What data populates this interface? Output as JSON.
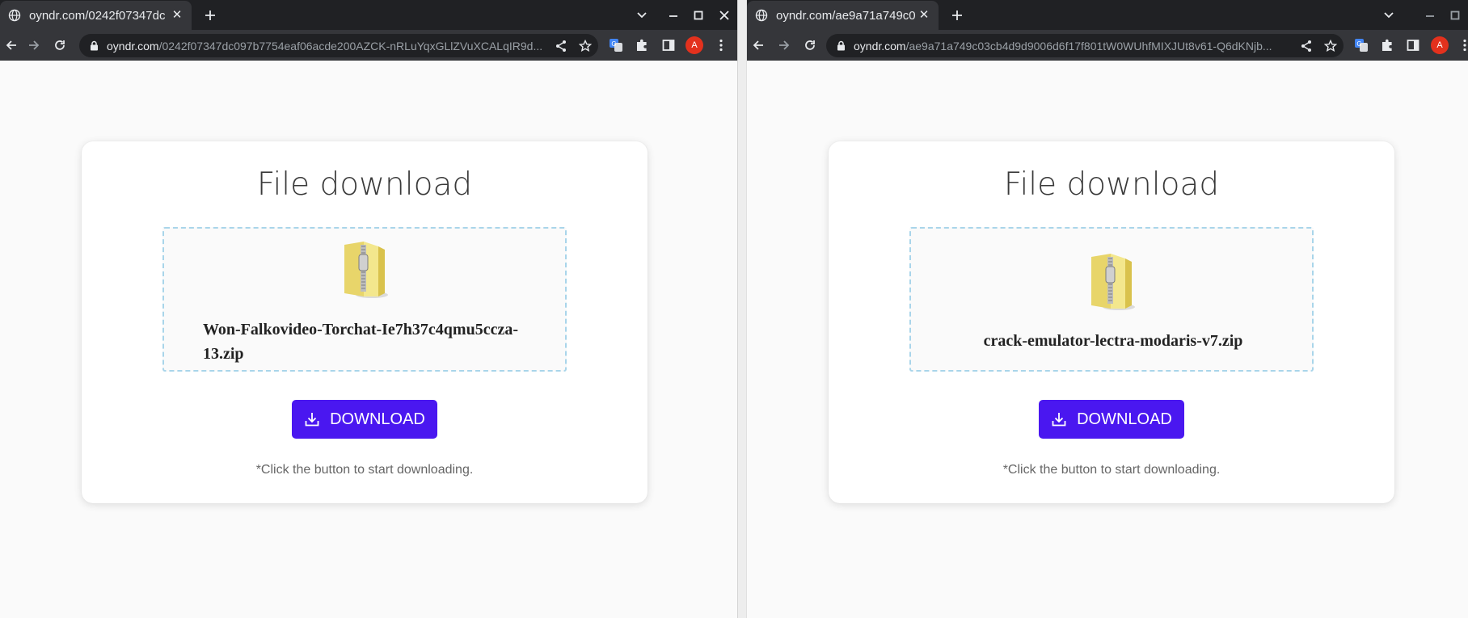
{
  "left": {
    "tab": {
      "title": "oyndr.com/0242f07347dc"
    },
    "address": {
      "domain": "oyndr.com",
      "path": "/0242f07347dc097b7754eaf06acde200AZCK-nRLuYqxGLlZVuXCALqIR9d..."
    },
    "avatar_letter": "A",
    "page": {
      "title": "File download",
      "file_name": "Won-Falkovideo-Torchat-Ie7h37c4qmu5ccza-13.zip",
      "button_label": "DOWNLOAD",
      "hint": "*Click the button to start downloading."
    }
  },
  "right": {
    "tab": {
      "title": "oyndr.com/ae9a71a749c0"
    },
    "address": {
      "domain": "oyndr.com",
      "path": "/ae9a71a749c03cb4d9d9006d6f17f801tW0WUhfMIXJUt8v61-Q6dKNjb..."
    },
    "avatar_letter": "A",
    "page": {
      "title": "File download",
      "file_name": "crack-emulator-lectra-modaris-v7.zip",
      "button_label": "DOWNLOAD",
      "hint": "*Click the button to start downloading."
    }
  },
  "icons": {
    "favicon": "globe-icon",
    "tab_close": "close-icon",
    "new_tab": "plus-icon",
    "tab_search": "chevron-down-icon",
    "minimize": "minimize-icon",
    "maximize": "maximize-icon",
    "close_window": "close-window-icon",
    "back": "back-arrow-icon",
    "forward": "forward-arrow-icon",
    "reload": "reload-icon",
    "lock": "lock-icon",
    "share": "share-icon",
    "bookmark": "star-icon",
    "translate": "translate-icon",
    "extensions": "puzzle-icon",
    "side_panel": "side-panel-icon",
    "menu": "kebab-menu-icon",
    "zip": "zip-folder-icon",
    "download": "download-icon"
  },
  "colors": {
    "tab_strip": "#202124",
    "toolbar": "#35363a",
    "button": "#4a17f0",
    "dropzone_border": "#a9d5ea",
    "avatar": "#e3311d"
  }
}
